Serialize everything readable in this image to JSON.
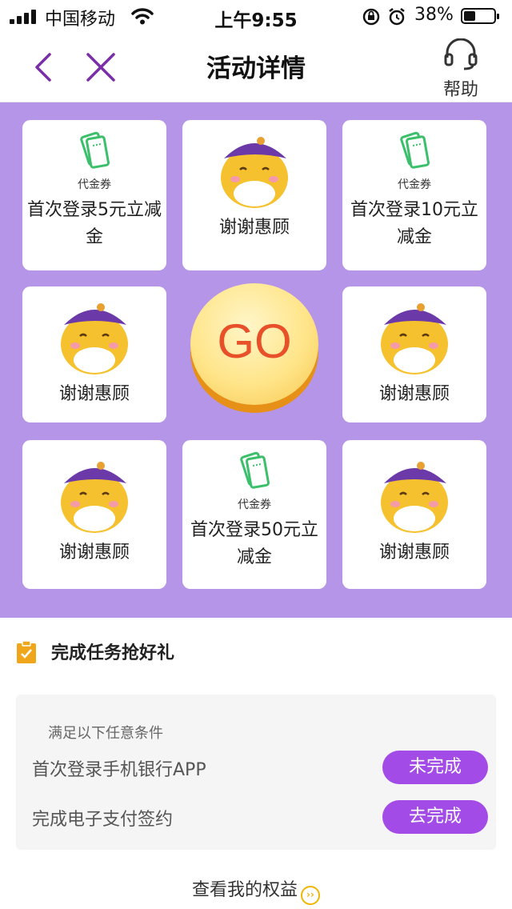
{
  "status_bar": {
    "carrier": "中国移动",
    "time": "上午9:55",
    "battery": "38%",
    "battery_level": 0.38
  },
  "nav": {
    "title": "活动详情",
    "help_label": "帮助",
    "icons": {
      "back": "chevron-left-icon",
      "close": "close-icon",
      "help": "headset-icon"
    }
  },
  "board": {
    "background": "#b595e8",
    "go_label": "GO",
    "cells": [
      {
        "type": "voucher",
        "tag": "代金券",
        "text": "首次登录5元立减金"
      },
      {
        "type": "thanks",
        "text": "谢谢惠顾"
      },
      {
        "type": "voucher",
        "tag": "代金券",
        "text": "首次登录10元立减金"
      },
      {
        "type": "thanks",
        "text": "谢谢惠顾"
      },
      {
        "type": "thanks",
        "text": "谢谢惠顾"
      },
      {
        "type": "thanks",
        "text": "谢谢惠顾"
      },
      {
        "type": "voucher",
        "tag": "代金券",
        "text": "首次登录50元立减金"
      },
      {
        "type": "thanks",
        "text": "谢谢惠顾"
      }
    ]
  },
  "tasks": {
    "title": "完成任务抢好礼",
    "hint": "满足以下任意条件",
    "items": [
      {
        "label": "首次登录手机银行APP",
        "button": "未完成"
      },
      {
        "label": "完成电子支付签约",
        "button": "去完成"
      }
    ],
    "button_color": "#a34be6"
  },
  "footer": {
    "rights_link": "查看我的权益"
  }
}
